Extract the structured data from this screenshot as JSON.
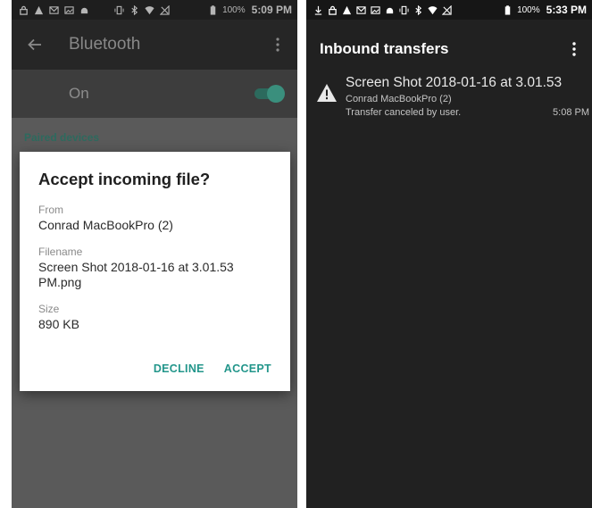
{
  "left_screen": {
    "status_bar": {
      "icons": [
        "lock-icon",
        "warning-icon",
        "gmail-icon",
        "image-icon",
        "android-icon",
        "vibrate-icon",
        "bluetooth-icon",
        "wifi-icon",
        "no-signal-icon",
        "battery-icon"
      ],
      "battery": "100%",
      "time": "5:09 PM"
    },
    "app_bar": {
      "title": "Bluetooth"
    },
    "toggle_row": {
      "label": "On",
      "state": "on"
    },
    "section_label": "Paired devices",
    "dialog": {
      "title": "Accept incoming file?",
      "from_label": "From",
      "from_value": "Conrad MacBookPro (2)",
      "filename_label": "Filename",
      "filename_value": "Screen Shot 2018-01-16 at 3.01.53 PM.png",
      "size_label": "Size",
      "size_value": "890 KB",
      "decline_label": "DECLINE",
      "accept_label": "ACCEPT"
    }
  },
  "right_screen": {
    "status_bar": {
      "icons": [
        "download-icon",
        "lock-icon",
        "warning-icon",
        "gmail-icon",
        "image-icon",
        "android-icon",
        "vibrate-icon",
        "bluetooth-icon",
        "wifi-icon",
        "no-signal-icon",
        "battery-icon"
      ],
      "battery": "100%",
      "time": "5:33 PM"
    },
    "app_bar": {
      "title": "Inbound transfers"
    },
    "transfers": [
      {
        "title": "Screen Shot 2018-01-16 at 3.01.53",
        "device": "Conrad MacBookPro (2)",
        "status": "Transfer canceled by user.",
        "time": "5:08 PM"
      }
    ]
  },
  "colors": {
    "accent": "#23968b",
    "dim_overlay": "#5a5a5a",
    "dark_bg": "#212121"
  }
}
